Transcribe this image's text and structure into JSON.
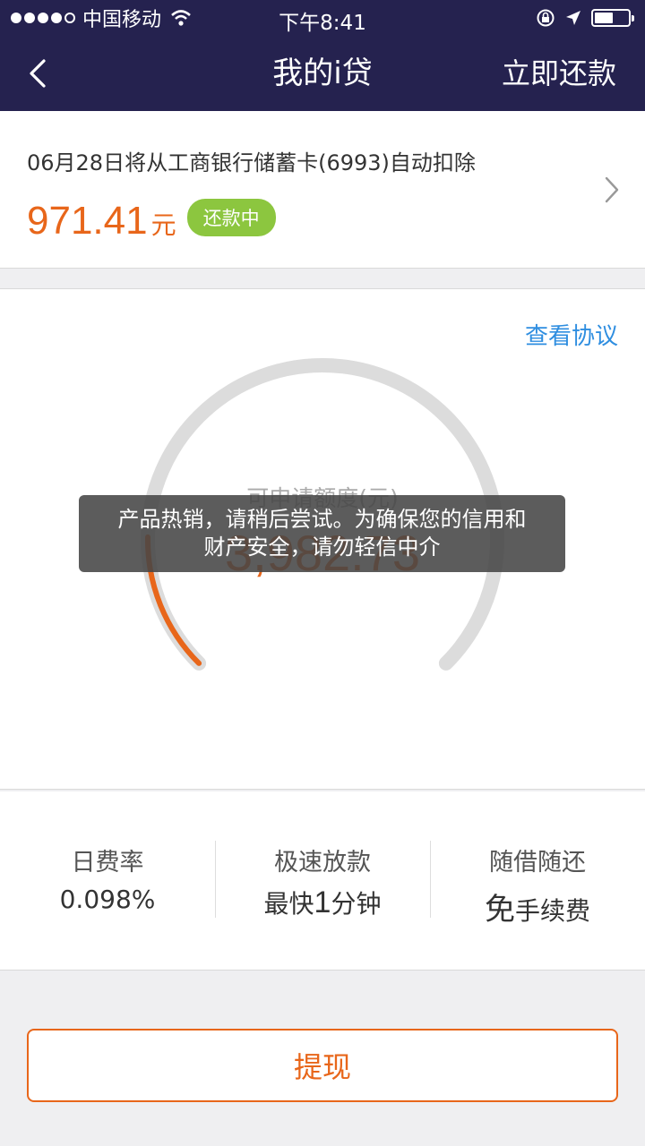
{
  "status_bar": {
    "carrier": "中国移动",
    "time": "下午8:41"
  },
  "nav": {
    "title": "我的i贷",
    "action_label": "立即还款"
  },
  "bill": {
    "description": "06月28日将从工商银行储蓄卡(6993)自动扣除",
    "amount": "971.41",
    "unit": "元",
    "status": "还款中"
  },
  "credit": {
    "agreement_label": "查看协议",
    "label": "可申请额度(元)",
    "value": "3,982.73",
    "used_fraction": 0.17
  },
  "toast": {
    "line1": "产品热销，请稍后尝试。为确保您的信用和",
    "line2": "财产安全，请勿轻信中介"
  },
  "features": [
    {
      "title": "日费率",
      "value": "0.098%"
    },
    {
      "title": "极速放款",
      "prefix": "最快",
      "big": "1",
      "suffix": "分钟"
    },
    {
      "title": "随借随还",
      "big": "免",
      "suffix": "手续费"
    }
  ],
  "withdraw_label": "提现",
  "colors": {
    "nav_bg": "#25224f",
    "accent": "#e8661a",
    "badge": "#8cc63f",
    "link": "#2f8ee0"
  }
}
